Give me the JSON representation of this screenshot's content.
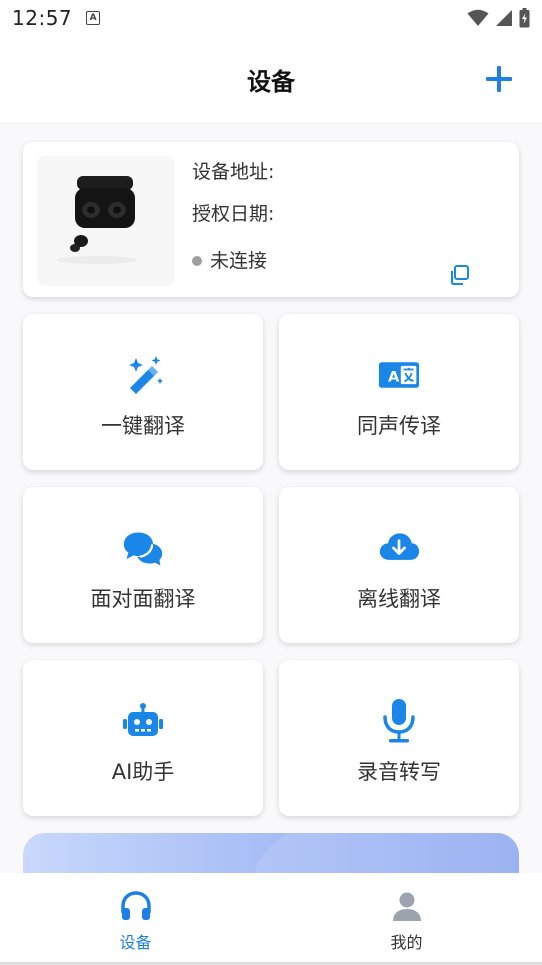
{
  "status_bar": {
    "time": "12:57",
    "app_icon_letter": "A"
  },
  "header": {
    "title": "设备",
    "add_icon": "plus-icon"
  },
  "device": {
    "address_label": "设备地址:",
    "date_label": "授权日期:",
    "status": "未连接",
    "status_color": "#9e9e9e"
  },
  "features": [
    {
      "label": "一键翻译",
      "icon": "magic-wand-icon"
    },
    {
      "label": "同声传译",
      "icon": "translate-icon"
    },
    {
      "label": "面对面翻译",
      "icon": "chat-bubbles-icon"
    },
    {
      "label": "离线翻译",
      "icon": "cloud-download-icon"
    },
    {
      "label": "AI助手",
      "icon": "robot-icon"
    },
    {
      "label": "录音转写",
      "icon": "microphone-icon"
    }
  ],
  "tabs": [
    {
      "label": "设备",
      "icon": "headphones-icon",
      "active": true
    },
    {
      "label": "我的",
      "icon": "person-icon",
      "active": false
    }
  ],
  "colors": {
    "accent": "#1e7fe6",
    "icon_blue": "#1a86e8",
    "inactive_icon": "#9ea4ad"
  }
}
